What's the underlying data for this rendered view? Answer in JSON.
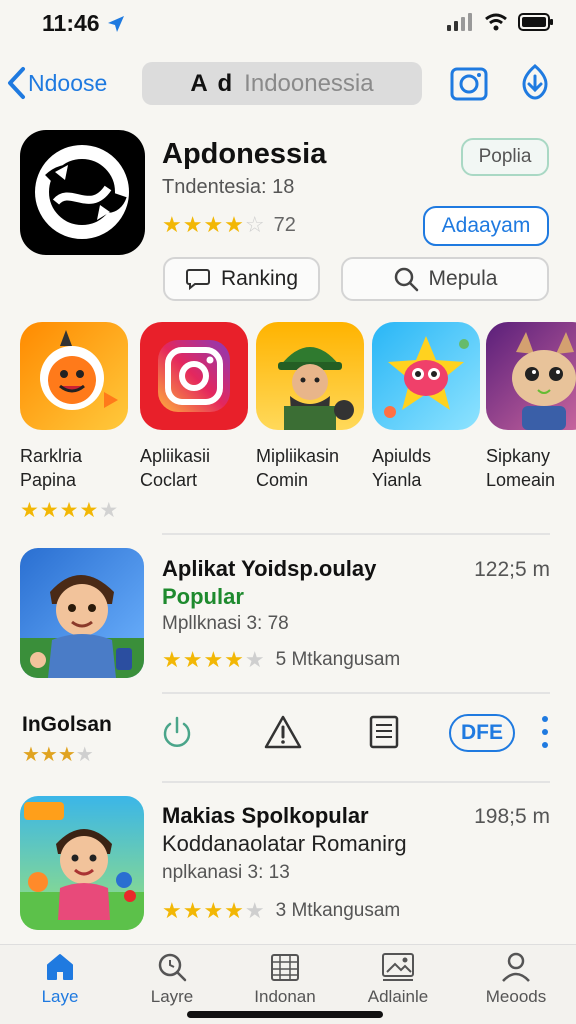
{
  "status": {
    "time": "11:46"
  },
  "nav": {
    "back_label": "Ndoose",
    "search_prefix": "A d",
    "search_text": "Indoonessia"
  },
  "app": {
    "title": "Apdonessia",
    "subtitle": "Tndentesia: 18",
    "rating": 4,
    "rating_count": "72",
    "popular_label": "Poplia",
    "get_label": "Adaayam",
    "ranking_label": "Ranking",
    "search_label": "Mepula"
  },
  "carousel": [
    {
      "line1": "Rarklria",
      "line2": "Papina",
      "stars": 4,
      "show_stars": true,
      "colors": [
        "#ff9a1a",
        "#ffcc33"
      ]
    },
    {
      "line1": "Apliikasii",
      "line2": "Coclart",
      "stars": 0,
      "show_stars": false,
      "colors": [
        "#ff2b2b",
        "#e60023"
      ]
    },
    {
      "line1": "Mipliikasin",
      "line2": "Comin",
      "stars": 0,
      "show_stars": false,
      "colors": [
        "#ffc21a",
        "#ffdf5e"
      ]
    },
    {
      "line1": "Apiulds",
      "line2": "Yianla",
      "stars": 0,
      "show_stars": false,
      "colors": [
        "#27c2f2",
        "#7be0ff"
      ]
    },
    {
      "line1": "Sipkany",
      "line2": "Lomeain",
      "stars": 0,
      "show_stars": false,
      "colors": [
        "#6a2c8e",
        "#c85a9a"
      ]
    }
  ],
  "rows": [
    {
      "title": "Aplikat Yoidsp.oulay",
      "badge": "Popular",
      "meta": "Mpllknasi 3: 78",
      "stars": 4,
      "reviews": "5 Mtkangusam",
      "size": "122;5 m"
    },
    {
      "title": "Makias Spolkopular",
      "subtitle": "Koddanaolatar Romanirg",
      "meta": "nplkanasi 3: 13",
      "stars": 4,
      "reviews": "3 Mtkangusam",
      "size": "198;5 m"
    }
  ],
  "action_row": {
    "label": "InGolsan",
    "stars": 2.5,
    "dfe_label": "DFE"
  },
  "tabs": [
    {
      "label": "Laye",
      "icon": "home-icon",
      "active": true
    },
    {
      "label": "Layre",
      "icon": "search-icon",
      "active": false
    },
    {
      "label": "Indonan",
      "icon": "calendar-icon",
      "active": false
    },
    {
      "label": "Adlainle",
      "icon": "image-icon",
      "active": false
    },
    {
      "label": "Meoods",
      "icon": "person-icon",
      "active": false
    }
  ],
  "colors": {
    "accent": "#1f7ae0",
    "star": "#f2b705",
    "popular": "#1e8a2e"
  }
}
